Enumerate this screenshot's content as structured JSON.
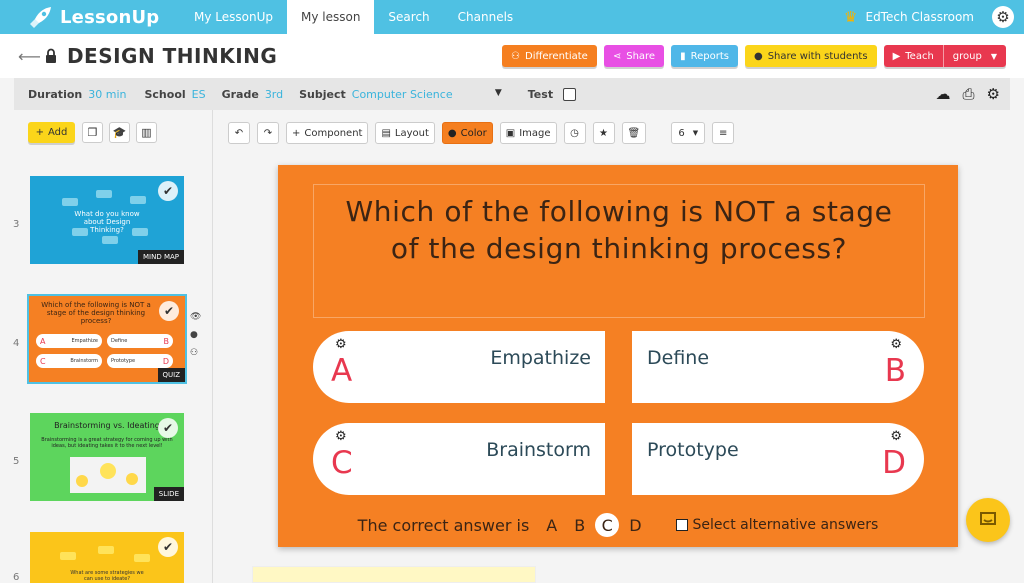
{
  "app": {
    "brand": "LessonUp",
    "nav_tabs": [
      {
        "label": "My LessonUp",
        "active": false
      },
      {
        "label": "My lesson",
        "active": true
      },
      {
        "label": "Search",
        "active": false
      },
      {
        "label": "Channels",
        "active": false
      }
    ],
    "account": "EdTech Classroom",
    "accent_color": "#4fc1e3"
  },
  "title_bar": {
    "back_icon": "arrow-left-icon",
    "lock_icon": "lock-icon",
    "title": "DESIGN THINKING",
    "buttons": {
      "differentiate": "Differentiate",
      "share": "Share",
      "reports": "Reports",
      "share_students": "Share with students",
      "teach": "Teach",
      "group": "group"
    }
  },
  "meta": {
    "duration_label": "Duration",
    "duration": "30 min",
    "school_label": "School",
    "school": "ES",
    "grade_label": "Grade",
    "grade": "3rd",
    "subject_label": "Subject",
    "subject": "Computer Science",
    "test_label": "Test",
    "test_checked": false
  },
  "left_panel": {
    "add_label": "Add",
    "slides": [
      {
        "number": "3",
        "text": "What do you know about Design Thinking?",
        "tag": "MIND MAP",
        "color": "#1fa3d6"
      },
      {
        "number": "4",
        "text": "Which of the following is NOT a stage of the design thinking process?",
        "tag": "QUIZ",
        "color": "#f58023",
        "options": [
          "A",
          "Empathize",
          "Define",
          "B",
          "C",
          "Brainstorm",
          "Prototype",
          "D"
        ]
      },
      {
        "number": "5",
        "title": "Brainstorming vs. Ideating",
        "text": "Brainstorming is a great strategy for coming up with ideas, but ideating takes it to the next level!",
        "tag": "SLIDE",
        "color": "#5dd55d"
      },
      {
        "number": "6",
        "text": "What are some strategies we can use to ideate?",
        "color": "#fbc51a"
      }
    ]
  },
  "toolbar": {
    "component": "Component",
    "layout": "Layout",
    "color": "Color",
    "image": "Image",
    "font_size": "6"
  },
  "slide": {
    "question": "Which of the following is NOT a stage of the design thinking process?",
    "answers": [
      {
        "letter": "A",
        "text": "Empathize"
      },
      {
        "letter": "B",
        "text": "Define"
      },
      {
        "letter": "C",
        "text": "Brainstorm"
      },
      {
        "letter": "D",
        "text": "Prototype"
      }
    ],
    "correct_label": "The correct answer is",
    "correct_letter": "C",
    "alt_label": "Select alternative answers",
    "background": "#f58023"
  }
}
